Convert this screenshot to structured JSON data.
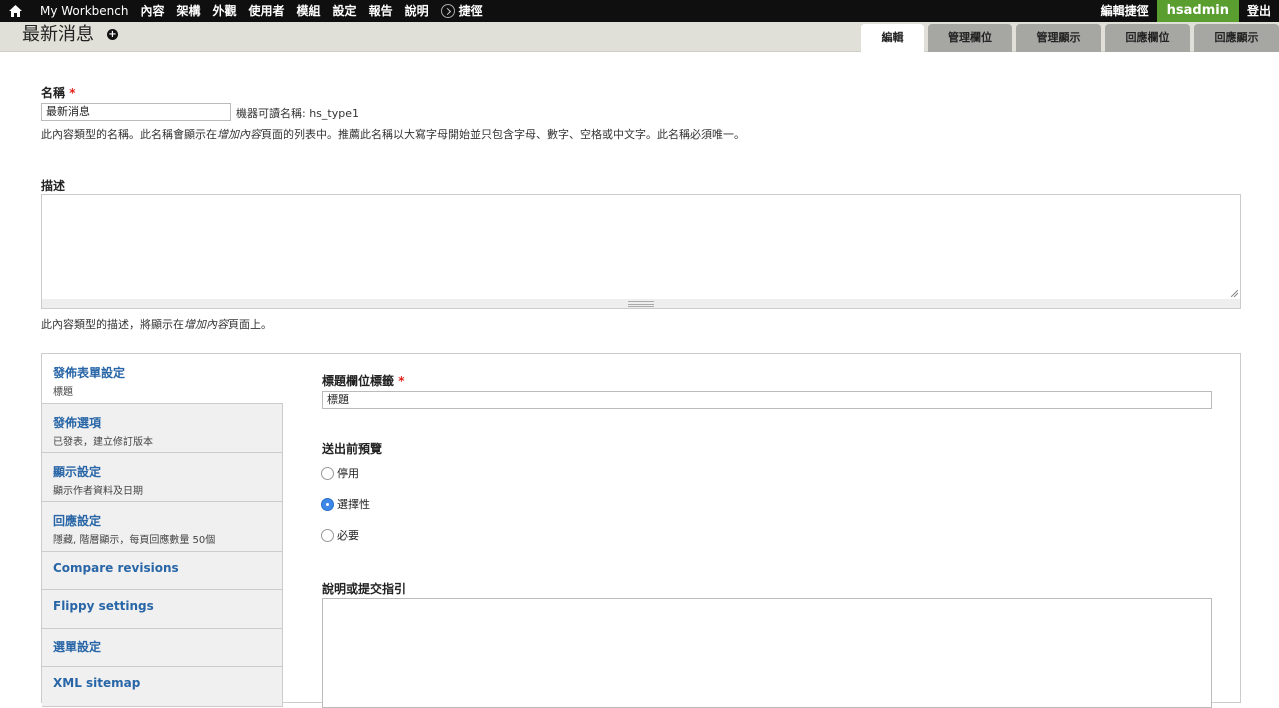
{
  "toolbar": {
    "home_icon": "home-icon",
    "menu": [
      "My Workbench",
      "內容",
      "架構",
      "外觀",
      "使用者",
      "模組",
      "設定",
      "報告",
      "說明"
    ],
    "shortcuts_label": "捷徑",
    "edit_shortcuts": "編輯捷徑",
    "username": "hsadmin",
    "logout": "登出"
  },
  "header": {
    "title": "最新消息",
    "tabs": [
      "編輯",
      "管理欄位",
      "管理顯示",
      "回應欄位",
      "回應顯示"
    ]
  },
  "form": {
    "name_label": "名稱",
    "required_mark": "*",
    "name_value": "最新消息",
    "machine_name": "機器可讀名稱: hs_type1",
    "name_help_1": "此內容類型的名稱。此名稱會顯示在",
    "name_help_em": "增加內容",
    "name_help_2": "頁面的列表中。推薦此名稱以大寫字母開始並只包含字母、數字、空格或中文字。此名稱必須唯一。",
    "desc_label": "描述",
    "desc_help_1": "此內容類型的描述，將顯示在",
    "desc_help_em": "增加內容",
    "desc_help_2": "頁面上。"
  },
  "vtabs": [
    {
      "title": "發佈表單設定",
      "summary": "標題"
    },
    {
      "title": "發佈選項",
      "summary": "已發表，建立修訂版本"
    },
    {
      "title": "顯示設定",
      "summary": "顯示作者資料及日期"
    },
    {
      "title": "回應設定",
      "summary": "隱藏, 階層顯示，每頁回應數量 50個"
    },
    {
      "title": "Compare revisions",
      "summary": ""
    },
    {
      "title": "Flippy settings",
      "summary": ""
    },
    {
      "title": "選單設定",
      "summary": ""
    },
    {
      "title": "XML sitemap",
      "summary": ""
    }
  ],
  "pane": {
    "title_label": "標題欄位標籤",
    "title_value": "標題",
    "preview_label": "送出前預覽",
    "preview_options": [
      "停用",
      "選擇性",
      "必要"
    ],
    "preview_selected": "選擇性",
    "help_label": "說明或提交指引"
  }
}
